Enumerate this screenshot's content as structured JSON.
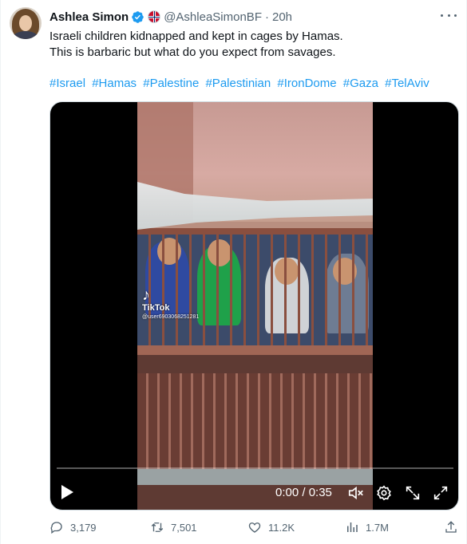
{
  "author": {
    "name": "Ashlea Simon",
    "handle": "@AshleaSimonBF",
    "separator": "·",
    "time": "20h"
  },
  "colors": {
    "link": "#1d9bf0",
    "secondary_text": "#536471",
    "verified": "#1d9bf0"
  },
  "tweet": {
    "line1": "Israeli children kidnapped and kept in cages by Hamas.",
    "line2": "This is barbaric but what do you expect from savages.",
    "hashtags": [
      "#Israel",
      "#Hamas",
      "#Palestine",
      "#Palestinian",
      "#IronDome",
      "#Gaza",
      "#TelAviv"
    ]
  },
  "video": {
    "watermark_brand": "TikTok",
    "watermark_user": "@user6903068251281",
    "timecode": "0:00 / 0:35",
    "progress_fraction": 0,
    "controls": [
      "play-icon",
      "mute-icon",
      "settings-gear-icon",
      "pip-icon",
      "fullscreen-icon"
    ]
  },
  "actions": {
    "replies": "3,179",
    "reposts": "7,501",
    "likes": "11.2K",
    "views": "1.7M"
  }
}
